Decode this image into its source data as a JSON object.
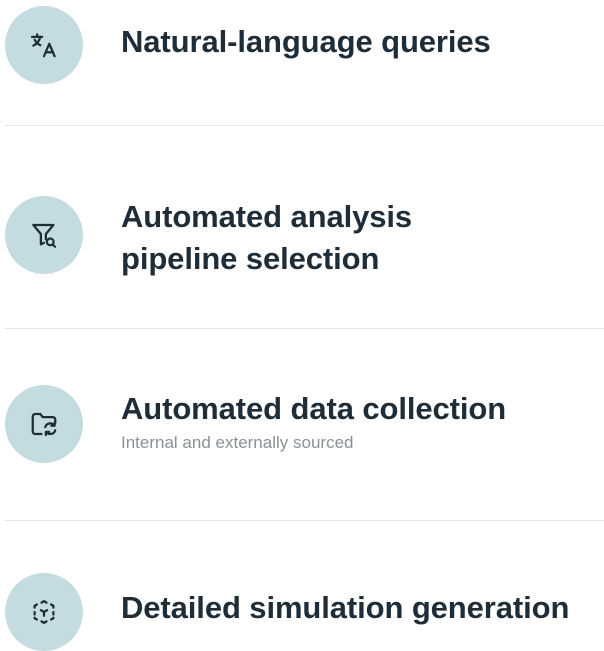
{
  "features": [
    {
      "icon": "translate-icon",
      "title_lines": [
        "Natural-language queries"
      ],
      "subtitle": ""
    },
    {
      "icon": "filter-search-icon",
      "title_lines": [
        "Automated analysis",
        "pipeline selection"
      ],
      "subtitle": ""
    },
    {
      "icon": "folder-sync-icon",
      "title_lines": [
        "Automated data collection"
      ],
      "subtitle": "Internal and externally sourced"
    },
    {
      "icon": "simulation-frame-icon",
      "title_lines": [
        "Detailed simulation generation"
      ],
      "subtitle": ""
    }
  ],
  "colors": {
    "icon_circle": "#c4dce0",
    "icon_stroke": "#1f2d38",
    "title": "#1f2d38",
    "subtitle": "#8a9196",
    "divider": "#e3e7ea"
  }
}
